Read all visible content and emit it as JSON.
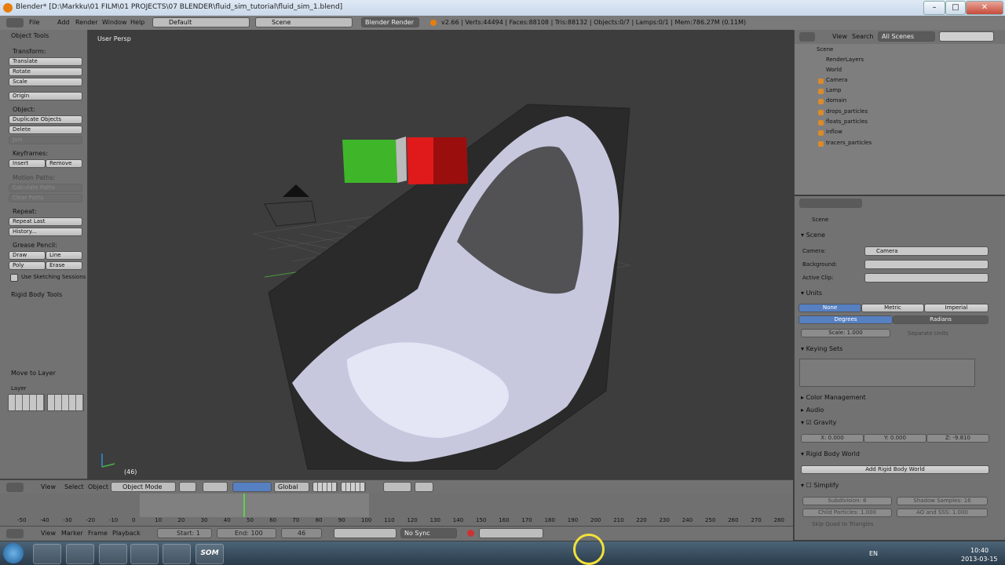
{
  "window": {
    "title": "Blender* [D:\\Markku\\01 FILM\\01 PROJECTS\\07 BLENDER\\fluid_sim_tutorial\\fluid_sim_1.blend]"
  },
  "header": {
    "menus": [
      "File",
      "Add",
      "Render",
      "Window",
      "Help"
    ],
    "layout": "Default",
    "scene": "Scene",
    "engine": "Blender Render",
    "stats": "v2.66 | Verts:44494 | Faces:88108 | Tris:88132 | Objects:0/7 | Lamps:0/1 | Mem:786.27M (0.11M)"
  },
  "toolshelf": {
    "title": "Object Tools",
    "transform_label": "Transform:",
    "translate": "Translate",
    "rotate": "Rotate",
    "scale": "Scale",
    "origin": "Origin",
    "object_label": "Object:",
    "duplicate": "Duplicate Objects",
    "delete": "Delete",
    "join": "Join",
    "keyframes_label": "Keyframes:",
    "insert": "Insert",
    "remove": "Remove",
    "motion_label": "Motion Paths:",
    "calc_paths": "Calculate Paths",
    "clear_paths": "Clear Paths",
    "repeat_label": "Repeat:",
    "repeat_last": "Repeat Last",
    "history": "History...",
    "grease_label": "Grease Pencil:",
    "draw": "Draw",
    "line": "Line",
    "poly": "Poly",
    "erase": "Erase",
    "sketching": "Use Sketching Sessions",
    "rigid": "Rigid Body Tools",
    "move_layer": "Move to Layer",
    "layer_label": "Layer"
  },
  "viewport": {
    "label": "User Persp",
    "frame": "(46)"
  },
  "vpheader": {
    "view": "View",
    "select": "Select",
    "object": "Object",
    "mode": "Object Mode",
    "orientation": "Global"
  },
  "timeline": {
    "ticks": [
      "-50",
      "-40",
      "-30",
      "-20",
      "-10",
      "0",
      "10",
      "20",
      "30",
      "40",
      "50",
      "60",
      "70",
      "80",
      "90",
      "100",
      "110",
      "120",
      "130",
      "140",
      "150",
      "160",
      "170",
      "180",
      "190",
      "200",
      "210",
      "220",
      "230",
      "240",
      "250",
      "260",
      "270",
      "280"
    ],
    "current_frame": 46,
    "view": "View",
    "marker": "Marker",
    "frame": "Frame",
    "playback": "Playback",
    "start": "Start: 1",
    "end": "End: 100",
    "current": "46",
    "sync": "No Sync"
  },
  "outliner": {
    "view": "View",
    "search": "Search",
    "scenes": "All Scenes",
    "items": [
      "Scene",
      "RenderLayers",
      "World",
      "Camera",
      "Lamp",
      "domain",
      "drops_particles",
      "floats_particles",
      "inflow",
      "tracers_particles"
    ]
  },
  "props": {
    "breadcrumb": "Scene",
    "scene_panel": "Scene",
    "camera_label": "Camera:",
    "camera_value": "Camera",
    "background_label": "Background:",
    "clip_label": "Active Clip:",
    "units": "Units",
    "none": "None",
    "metric": "Metric",
    "imperial": "Imperial",
    "degrees": "Degrees",
    "radians": "Radians",
    "scale": "Scale: 1.000",
    "separate": "Separate Units",
    "keying": "Keying Sets",
    "color_mgmt": "Color Management",
    "audio": "Audio",
    "gravity": "Gravity",
    "gx": "X: 0.000",
    "gy": "Y: 0.000",
    "gz": "Z: -9.810",
    "rigid_world": "Rigid Body World",
    "add_rigid": "Add Rigid Body World",
    "simplify": "Simplify",
    "subdivision": "Subdivision: 6",
    "shadow": "Shadow Samples: 16",
    "child": "Child Particles: 1.000",
    "ao": "AO and SSS: 1.000",
    "skip_quad": "Skip Quad to Triangles"
  },
  "taskbar": {
    "lang": "EN",
    "time": "10:40",
    "date": "2013-03-15",
    "som": "SOM"
  },
  "colors": {
    "accent": "#5680c2",
    "bg": "#727272"
  }
}
